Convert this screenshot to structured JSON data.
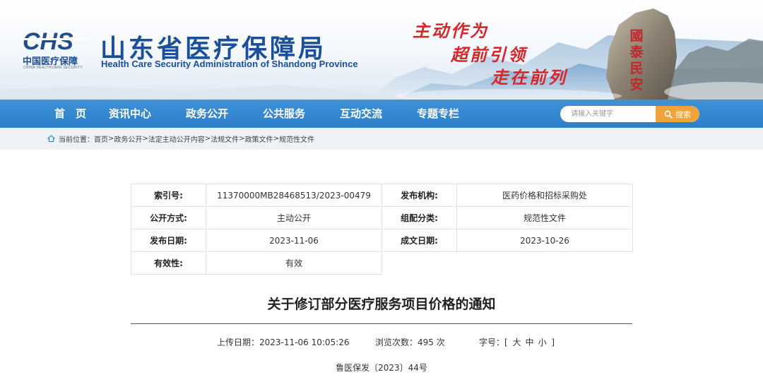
{
  "header": {
    "logo_mark": "CHS",
    "logo_cn": "中国医疗保障",
    "logo_en": "CHINA HEALTHCARE SECURITY",
    "site_title": "山东省医疗保障局",
    "site_subtitle": "Health Care Security Administration of Shandong Province",
    "slogan": [
      "主动作为",
      "超前引领",
      "走在前列"
    ],
    "rock_inscription": "國泰民安",
    "colors": {
      "title_blue": "#1b4f9a",
      "slogan_red": "#d8262a"
    }
  },
  "nav": {
    "items": [
      {
        "label": "首　页"
      },
      {
        "label": "资讯中心"
      },
      {
        "label": "政务公开"
      },
      {
        "label": "公共服务"
      },
      {
        "label": "互动交流"
      },
      {
        "label": "专题专栏"
      }
    ],
    "search": {
      "placeholder": "请输入关键字",
      "button_label": "搜索",
      "icon": "search-icon"
    },
    "colors": {
      "bar": "#3487d0",
      "search_button": "#f0a33a"
    }
  },
  "breadcrumb": {
    "prefix": "当前位置：",
    "icon": "location-pin-icon",
    "items": [
      "首页",
      "政务公开",
      "法定主动公开内容",
      "法规文件",
      "政策文件",
      "规范性文件"
    ],
    "separator": ">"
  },
  "info_table": {
    "rows": [
      [
        {
          "key": "索引号:",
          "value": "11370000MB28468513/2023-00479"
        },
        {
          "key": "发布机构:",
          "value": "医药价格和招标采购处"
        }
      ],
      [
        {
          "key": "公开方式:",
          "value": "主动公开"
        },
        {
          "key": "组配分类:",
          "value": "规范性文件"
        }
      ],
      [
        {
          "key": "发布日期:",
          "value": "2023-11-06"
        },
        {
          "key": "成文日期:",
          "value": "2023-10-26"
        }
      ],
      [
        {
          "key": "有效性:",
          "value": "有效"
        }
      ]
    ]
  },
  "article": {
    "title": "关于修订部分医疗服务项目价格的通知",
    "upload_label": "上传日期：",
    "upload_date": "2023-11-06 10:05:26",
    "views_label": "浏览次数：",
    "views_count": "495",
    "views_unit": "次",
    "font_size_label": "字号：",
    "font_size_open": "[",
    "font_size_options": [
      "大",
      "中",
      "小"
    ],
    "font_size_close": "]",
    "doc_number": "鲁医保发〔2023〕44号"
  }
}
